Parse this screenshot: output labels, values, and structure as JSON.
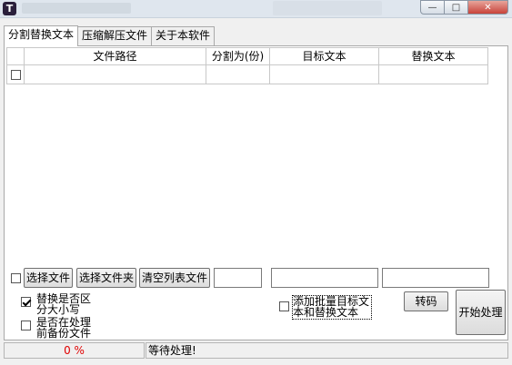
{
  "window": {
    "close_glyph": "✕",
    "max_glyph": "□",
    "min_glyph": "—",
    "app_icon_letter": "T"
  },
  "tabs": [
    {
      "label": "分割替换文本",
      "active": true
    },
    {
      "label": "压缩解压文件",
      "active": false
    },
    {
      "label": "关于本软件",
      "active": false
    }
  ],
  "table": {
    "columns": [
      "",
      "文件路径",
      "分割为(份)",
      "目标文本",
      "替换文本"
    ],
    "rows": [
      {
        "checked": false,
        "path": "",
        "parts": "",
        "target": "",
        "replace": ""
      }
    ]
  },
  "controls": {
    "select_file_label": "选择文件",
    "select_folder_label": "选择文件夹",
    "clear_list_label": "清空列表文件",
    "parts_value": "",
    "target_value": "",
    "replace_value": "",
    "case_sensitive_label_1": "替换是否区",
    "case_sensitive_label_2": "分大小写",
    "case_sensitive_checked": true,
    "backup_label_1": "是否在处理",
    "backup_label_2": "前备份文件",
    "backup_checked": false,
    "batch_label_1": "添加批量目标文",
    "batch_label_2": "本和替换文本",
    "batch_checked": false,
    "transcode_label": "转码",
    "start_label": "开始处理"
  },
  "status": {
    "progress": "0 %",
    "message": "等待处理!"
  }
}
